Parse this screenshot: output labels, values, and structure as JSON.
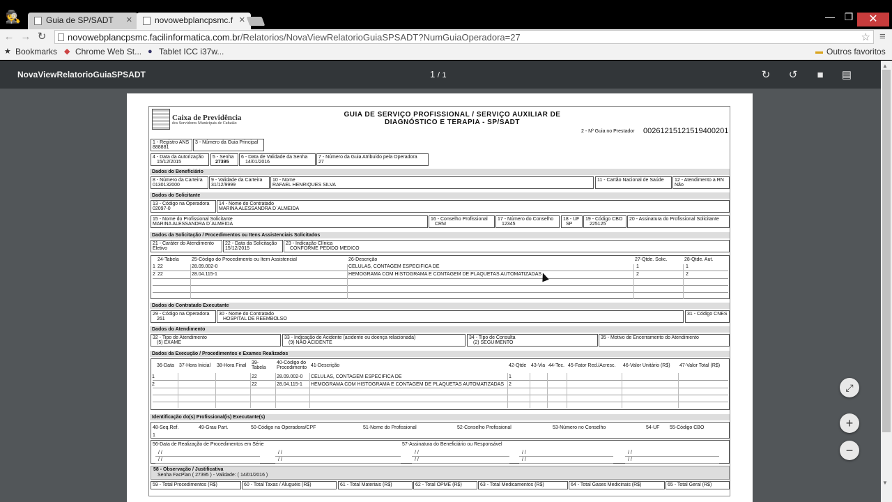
{
  "browser": {
    "tabs": [
      {
        "label": "Guia de SP/SADT"
      },
      {
        "label": "novowebplancpsmc.f"
      }
    ],
    "url_host": "novowebplancpsmc.facilinformatica.com.br",
    "url_path": "/Relatorios/NovaViewRelatorioGuiaSPSADT?NumGuiaOperadora=27",
    "bookmarks": [
      {
        "label": "Bookmarks"
      },
      {
        "label": "Chrome Web St..."
      },
      {
        "label": "Tablet ICC i37w..."
      }
    ],
    "other_bookmarks": "Outros favoritos"
  },
  "viewer": {
    "title": "NovaViewRelatorioGuiaSPSADT",
    "page_current": "1",
    "page_sep": "/",
    "page_total": "1"
  },
  "form": {
    "org_name": "Caixa de Previdência",
    "org_sub": "dos Servidores Municipais de Cubatão",
    "title_line1": "GUIA DE SERVIÇO PROFISSIONAL / SERVIÇO AUXILIAR DE",
    "title_line2": "DIAGNÓSTICO E TERAPIA - SP/SADT",
    "guia_prestador_label": "2 - Nº Guia no Prestador",
    "guia_prestador_value": "00261215121519400201",
    "f1_label": "1 - Registro ANS",
    "f1_value": "888881",
    "f3_label": "3 - Número da Guia Principal",
    "f4_label": "4 - Data da Autorização",
    "f4_value": "15/12/2015",
    "f5_label": "5 - Senha",
    "f5_value": "27395",
    "f6_label": "6 - Data de Validade da Senha",
    "f6_value": "14/01/2016",
    "f7_label": "7 - Número da Guia Atribuído pela Operadora",
    "f7_value": "27",
    "sec_benef": "Dados do Beneficiário",
    "f8_label": "8 - Número da Carteira",
    "f8_value": "0130132000",
    "f9_label": "9 - Validade da Carteira",
    "f9_value": "31/12/9999",
    "f10_label": "10 - Nome",
    "f10_value": "RAFAEL HENRIQUES SILVA",
    "f11_label": "11 - Cartão Nacional de Saúde",
    "f12_label": "12 - Atendimento a RN",
    "f12_value": "Não",
    "sec_solic": "Dados do Solicitante",
    "f13_label": "13 - Código na Operadora",
    "f13_value": "02097-0",
    "f14_label": "14 - Nome do Contratado",
    "f14_value": "MARINA ALESSANDRA D`ALMEIDA",
    "f15_label": "15 - Nome do Profissional Solicitante",
    "f15_value": "MARINA ALESSANDRA D`ALMEIDA",
    "f16_label": "16 - Conselho Profissional",
    "f16_value": "CRM",
    "f17_label": "17 - Número do Conselho",
    "f17_value": "12345",
    "f18_label": "18 - UF",
    "f18_value": "SP",
    "f19_label": "19 - Código CBO",
    "f19_value": "225125",
    "f20_label": "20 - Assinatura do Profissional Solicitante",
    "sec_solicitacao": "Dados da Solicitação / Procedimentos ou Itens Assistenciais Solicitados",
    "f21_label": "21 - Caráter do Atendimento",
    "f21_value": "Eletivo",
    "f22_label": "22 - Data da Solicitação",
    "f22_value": "15/12/2015",
    "f23_label": "23 - Indicação Clínica",
    "f23_value": "CONFORME PEDIDO MEDICO",
    "proc_headers": [
      "24-Tabela",
      "25-Código do Procedimento ou Item Assistencial",
      "26-Descrição",
      "27-Qtde. Solic.",
      "28-Qtde. Aut."
    ],
    "proc_rows": [
      {
        "n": "1",
        "tab": "22",
        "code": "28.09.002-0",
        "desc": "CELULAS, CONTAGEM ESPECIFICA DE",
        "qs": "1",
        "qa": "1"
      },
      {
        "n": "2",
        "tab": "22",
        "code": "28.04.115-1",
        "desc": "HEMOGRAMA COM HISTOGRAMA E CONTAGEM DE PLAQUETAS AUTOMATIZADAS",
        "qs": "2",
        "qa": "2"
      }
    ],
    "sec_contratado": "Dados do Contratado Executante",
    "f29_label": "29 - Código na Operadora",
    "f29_value": "261",
    "f30_label": "30 - Nome do Contratado",
    "f30_value": "HOSPITAL DE REEMBOLSO",
    "f31_label": "31 - Código CNES",
    "sec_atend": "Dados do Atendimento",
    "f32_label": "32 - Tipo de Atendimento",
    "f32_value": "(5) EXAME",
    "f33_label": "33 - Indicação de Acidente (acidente ou doença relacionada)",
    "f33_value": "(9) NÃO ACIDENTE",
    "f34_label": "34 - Tipo de Consulta",
    "f34_value": "(2) SEGUIMENTO",
    "f35_label": "35 - Motivo de Encerramento do Atendimento",
    "sec_exec": "Dados da Execução / Procedimentos e Exames Realizados",
    "exec_headers": [
      "36-Data",
      "37-Hora Inicial",
      "38-Hora Final",
      "39-Tabela",
      "40-Código do Procedimento",
      "41-Descrição",
      "42-Qtde",
      "43-Via",
      "44-Tec.",
      "45-Fator Red./Acresc.",
      "46-Valor Unitário (R$)",
      "47-Valor Total (R$)"
    ],
    "exec_rows": [
      {
        "n": "1",
        "tab": "22",
        "code": "28.09.002-0",
        "desc": "CELULAS, CONTAGEM ESPECIFICA DE",
        "q": "1"
      },
      {
        "n": "2",
        "tab": "22",
        "code": "28.04.115-1",
        "desc": "HEMOGRAMA COM HISTOGRAMA E CONTAGEM DE PLAQUETAS AUTOMATIZADAS",
        "q": "2"
      }
    ],
    "sec_prof": "Identificação do(s) Profissional(is) Executante(s)",
    "prof_headers": [
      "48-Seq.Ref.",
      "49-Grau Part.",
      "50-Código na Operadora/CPF",
      "51-Nome do Profissional",
      "52-Conselho Profissional",
      "53-Número no Conselho",
      "54-UF",
      "55-Código CBO"
    ],
    "prof_row_n": "1",
    "f56_label": "56-Data de Realização de Procedimentos em Série",
    "f57_label": "57-Assinatura do Beneficiário ou Responsável",
    "date_blank": "/ /",
    "f58_label": "58 - Observação / Justificativa",
    "f58_value": "Senha FacPlan ( 27395 ) - Validade: ( 14/01/2016 )",
    "totals": [
      "59 - Total Procedimentos (R$)",
      "60 - Total Taxas / Aluguéis (R$)",
      "61 - Total Materiais (R$)",
      "62 - Total OPME (R$)",
      "63 - Total Medicamentos (R$)",
      "64 - Total Gases Medicinais (R$)",
      "65 - Total Geral (R$)"
    ]
  }
}
